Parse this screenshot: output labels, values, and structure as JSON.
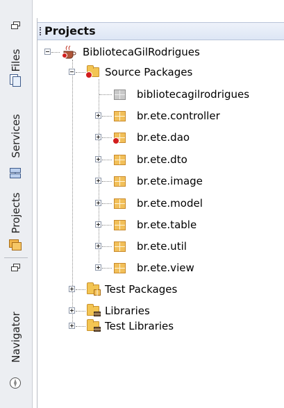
{
  "sidebar": {
    "items": [
      {
        "label": "Files",
        "icon": "files-icon"
      },
      {
        "label": "Services",
        "icon": "services-icon"
      },
      {
        "label": "Projects",
        "icon": "projects-icon"
      },
      {
        "label": "Navigator",
        "icon": "navigator-icon"
      }
    ]
  },
  "panel": {
    "title": "Projects"
  },
  "tree": {
    "root": {
      "label": "BibliotecaGilRodrigues",
      "error": true,
      "expanded": true
    },
    "source_packages": {
      "label": "Source Packages",
      "error": true,
      "expanded": true
    },
    "packages": [
      {
        "label": "bibliotecagilrodrigues",
        "empty": true,
        "error": false
      },
      {
        "label": "br.ete.controller",
        "empty": false,
        "error": false
      },
      {
        "label": "br.ete.dao",
        "empty": false,
        "error": true
      },
      {
        "label": "br.ete.dto",
        "empty": false,
        "error": false
      },
      {
        "label": "br.ete.image",
        "empty": false,
        "error": false
      },
      {
        "label": "br.ete.model",
        "empty": false,
        "error": false
      },
      {
        "label": "br.ete.table",
        "empty": false,
        "error": false
      },
      {
        "label": "br.ete.util",
        "empty": false,
        "error": false
      },
      {
        "label": "br.ete.view",
        "empty": false,
        "error": false
      }
    ],
    "others": [
      {
        "label": "Test Packages"
      },
      {
        "label": "Libraries"
      },
      {
        "label": "Test Libraries"
      }
    ]
  },
  "colors": {
    "error": "#d21d1d",
    "package": "#f2c05a",
    "header": "#dde6f5"
  }
}
